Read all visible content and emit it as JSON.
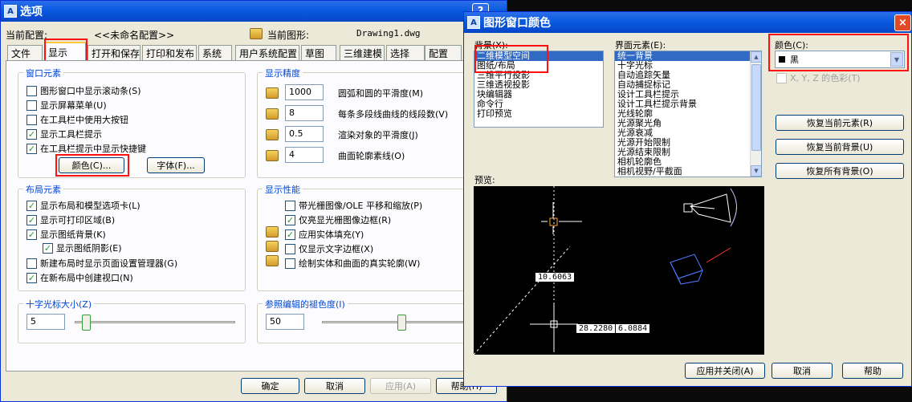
{
  "options_dialog": {
    "title": "选项",
    "current_profile_label": "当前配置:",
    "current_profile_value": "<<未命名配置>>",
    "current_drawing_label": "当前图形:",
    "current_drawing_value": "Drawing1.dwg",
    "tabs": [
      {
        "label": "文件"
      },
      {
        "label": "显示"
      },
      {
        "label": "打开和保存"
      },
      {
        "label": "打印和发布"
      },
      {
        "label": "系统"
      },
      {
        "label": "用户系统配置"
      },
      {
        "label": "草图"
      },
      {
        "label": "三维建模"
      },
      {
        "label": "选择"
      },
      {
        "label": "配置"
      }
    ],
    "window_elements": {
      "title": "窗口元素",
      "checkboxes": [
        {
          "label": "图形窗口中显示滚动条(S)",
          "checked": false
        },
        {
          "label": "显示屏幕菜单(U)",
          "checked": false
        },
        {
          "label": "在工具栏中使用大按钮",
          "checked": false
        },
        {
          "label": "显示工具栏提示",
          "checked": true
        },
        {
          "label": "在工具栏提示中显示快捷键",
          "checked": true
        }
      ],
      "colors_button": "颜色(C)...",
      "fonts_button": "字体(F)..."
    },
    "display_resolution": {
      "title": "显示精度",
      "rows": [
        {
          "value": "1000",
          "label": "圆弧和圆的平滑度(M)"
        },
        {
          "value": "8",
          "label": "每条多段线曲线的线段数(V)"
        },
        {
          "value": "0.5",
          "label": "渲染对象的平滑度(J)"
        },
        {
          "value": "4",
          "label": "曲面轮廓素线(O)"
        }
      ]
    },
    "layout_elements": {
      "title": "布局元素",
      "checkboxes": [
        {
          "label": "显示布局和模型选项卡(L)",
          "checked": true
        },
        {
          "label": "显示可打印区域(B)",
          "checked": true
        },
        {
          "label": "显示图纸背景(K)",
          "checked": true
        },
        {
          "label": "显示图纸阴影(E)",
          "checked": true
        },
        {
          "label": "新建布局时显示页面设置管理器(G)",
          "checked": false
        },
        {
          "label": "在新布局中创建视口(N)",
          "checked": true
        }
      ]
    },
    "display_performance": {
      "title": "显示性能",
      "checkboxes": [
        {
          "label": "带光栅图像/OLE 平移和缩放(P)",
          "checked": false
        },
        {
          "label": "仅亮显光栅图像边框(R)",
          "checked": true
        },
        {
          "label": "应用实体填充(Y)",
          "checked": true
        },
        {
          "label": "仅显示文字边框(X)",
          "checked": false
        },
        {
          "label": "绘制实体和曲面的真实轮廓(W)",
          "checked": false
        }
      ]
    },
    "crosshair": {
      "title": "十字光标大小(Z)",
      "value": "5",
      "level": 5
    },
    "xref_fade": {
      "title": "参照编辑的褪色度(I)",
      "value": "50",
      "level": 50
    },
    "buttons": {
      "ok": "确定",
      "cancel": "取消",
      "apply": "应用(A)",
      "help": "帮助(H)"
    }
  },
  "color_dialog": {
    "title": "图形窗口颜色",
    "context_label": "背景(X):",
    "contexts": [
      "二维模型空间",
      "图纸/布局",
      "三维平行投影",
      "三维透视投影",
      "块编辑器",
      "命令行",
      "打印预览"
    ],
    "element_label": "界面元素(E):",
    "elements": [
      "统一背景",
      "十字光标",
      "自动追踪矢量",
      "自动捕捉标记",
      "设计工具栏提示",
      "设计工具栏提示背景",
      "光线轮廓",
      "光源聚光角",
      "光源衰减",
      "光源开始限制",
      "光源结束限制",
      "相机轮廓色",
      "相机视野/平截面"
    ],
    "color_label": "颜色(C):",
    "color_value": "黑",
    "tint_label": "X, Y, Z 的色彩(T)",
    "restore_element": "恢复当前元素(R)",
    "restore_context": "恢复当前背景(U)",
    "restore_all": "恢复所有背景(O)",
    "preview_label": "预览:",
    "preview": {
      "dim1": "10.6063",
      "dim2": "28.2280",
      "dim3": "6.0884"
    },
    "buttons": {
      "apply_close": "应用并关闭(A)",
      "cancel": "取消",
      "help": "帮助"
    }
  }
}
